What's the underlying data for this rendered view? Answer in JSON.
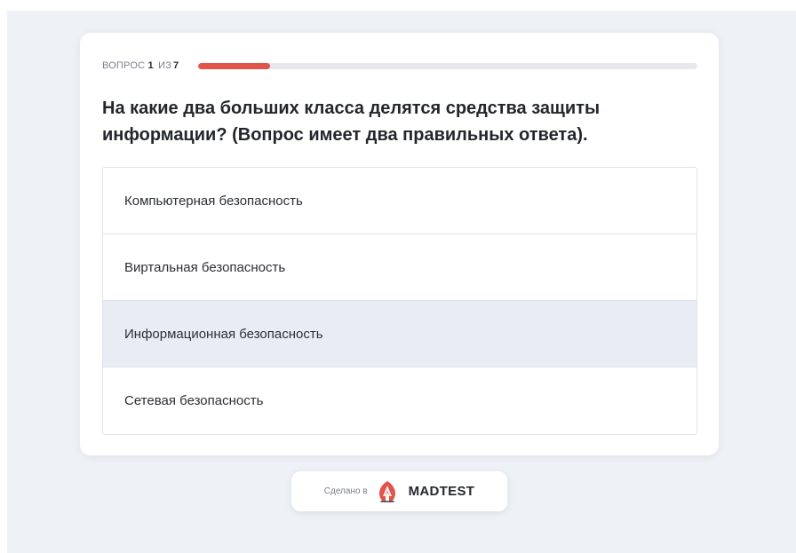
{
  "progress": {
    "label": "ВОПРОС",
    "current": "1",
    "of": "ИЗ",
    "total": "7",
    "fraction": 0.142857
  },
  "question": {
    "text": "На какие два больших класса делятся средства защиты информации? (Вопрос имеет два правильных ответа)."
  },
  "options": [
    {
      "label": "Компьютерная безопасность"
    },
    {
      "label": "Виртальная безопасность"
    },
    {
      "label": "Информационная безопасность",
      "highlighted": true
    },
    {
      "label": "Сетевая безопасность"
    }
  ],
  "footer": {
    "made_in": "Сделано в",
    "brand": "MADTEST",
    "logo_icon": "madtest-logo-icon"
  },
  "colors": {
    "accent": "#e2534a",
    "background": "#eef1f6",
    "highlight": "#e8edf5"
  }
}
